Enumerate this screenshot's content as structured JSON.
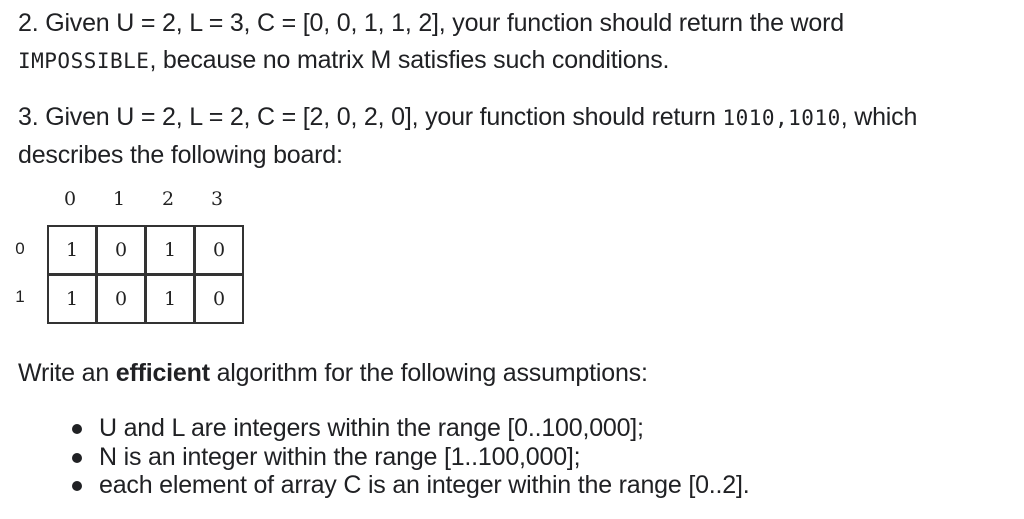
{
  "example2": {
    "line1": "2. Given U = 2, L = 3, C = [0, 0, 1, 1, 2], your function should return the word",
    "code": "IMPOSSIBLE",
    "line2_rest": ", because no matrix M satisfies such conditions."
  },
  "example3": {
    "line1_pre": "3. Given U = 2, L = 2, C = [2, 0, 2, 0], your function should return ",
    "code": "1010,1010",
    "line1_post": ", which",
    "line2": "describes the following board:"
  },
  "board": {
    "col_headers": [
      "0",
      "1",
      "2",
      "3"
    ],
    "row_headers": [
      "0",
      "1"
    ],
    "rows": [
      [
        "1",
        "0",
        "1",
        "0"
      ],
      [
        "1",
        "0",
        "1",
        "0"
      ]
    ]
  },
  "instruction": {
    "pre": "Write an ",
    "bold": "efficient",
    "post": " algorithm for the following assumptions:"
  },
  "assumptions": [
    "U and L are integers within the range [0..100,000];",
    "N is an integer within the range [1..100,000];",
    "each element of array C is an integer within the range [0..2]."
  ]
}
